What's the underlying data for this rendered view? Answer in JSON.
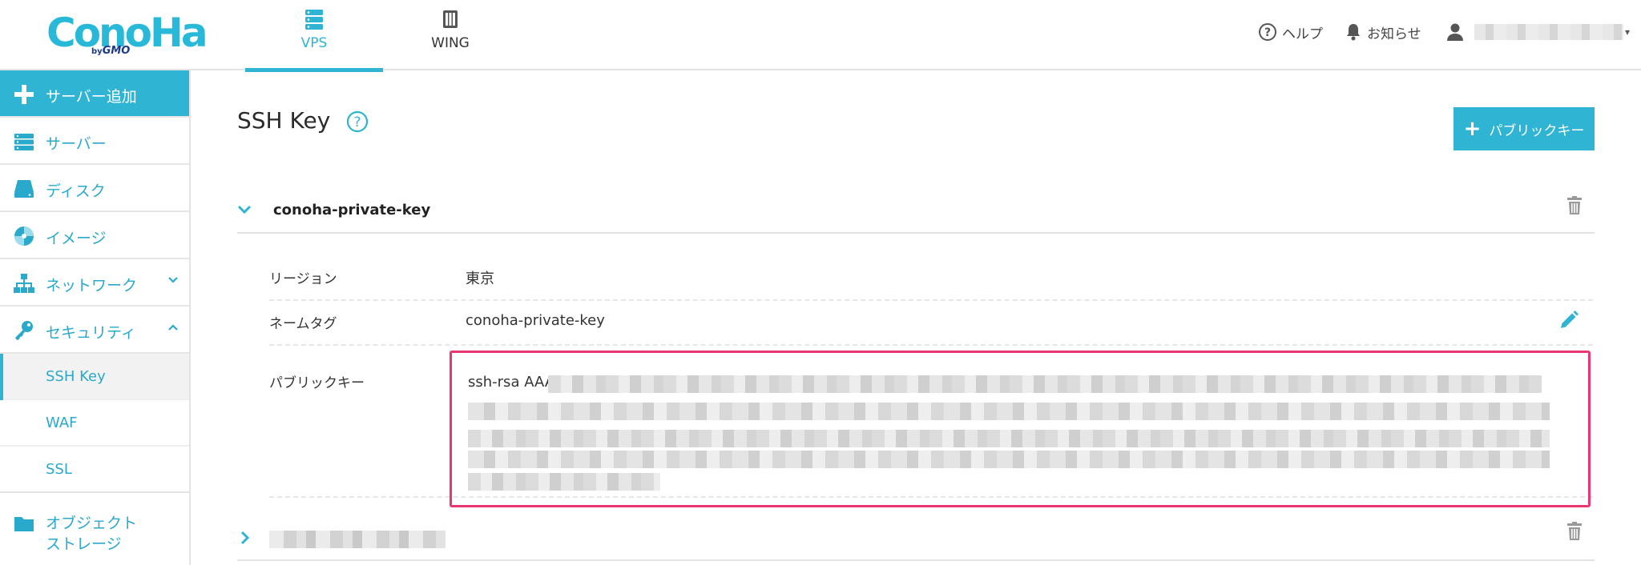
{
  "header": {
    "logo_main": "ConoHa",
    "logo_by": "by",
    "logo_gmo": "GMO",
    "tabs": [
      {
        "label": "VPS",
        "icon": "server-stack-icon",
        "active": true
      },
      {
        "label": "WING",
        "icon": "wing-server-icon",
        "active": false
      }
    ],
    "help_label": "ヘルプ",
    "notice_label": "お知らせ",
    "user_caret": "▾"
  },
  "sidebar": {
    "add_server": "サーバー追加",
    "items": [
      {
        "label": "サーバー",
        "icon": "server-icon"
      },
      {
        "label": "ディスク",
        "icon": "disk-icon"
      },
      {
        "label": "イメージ",
        "icon": "image-disc-icon"
      },
      {
        "label": "ネットワーク",
        "icon": "network-icon"
      },
      {
        "label": "セキュリティ",
        "icon": "key-icon"
      }
    ],
    "security_sub": [
      "SSH Key",
      "WAF",
      "SSL"
    ],
    "object_storage_line1": "オブジェクト",
    "object_storage_line2": "ストレージ"
  },
  "main": {
    "title": "SSH Key",
    "add_button_label": "パブリックキー",
    "keys": [
      {
        "name": "conoha-private-key",
        "expanded": true,
        "region_label": "リージョン",
        "region_value": "東京",
        "nametag_label": "ネームタグ",
        "nametag_value": "conoha-private-key",
        "pubkey_label": "パブリックキー",
        "pubkey_value_prefix": "ssh-rsa AAA"
      }
    ]
  },
  "colors": {
    "accent": "#2fb5d3",
    "highlight_border": "#e9366e"
  }
}
